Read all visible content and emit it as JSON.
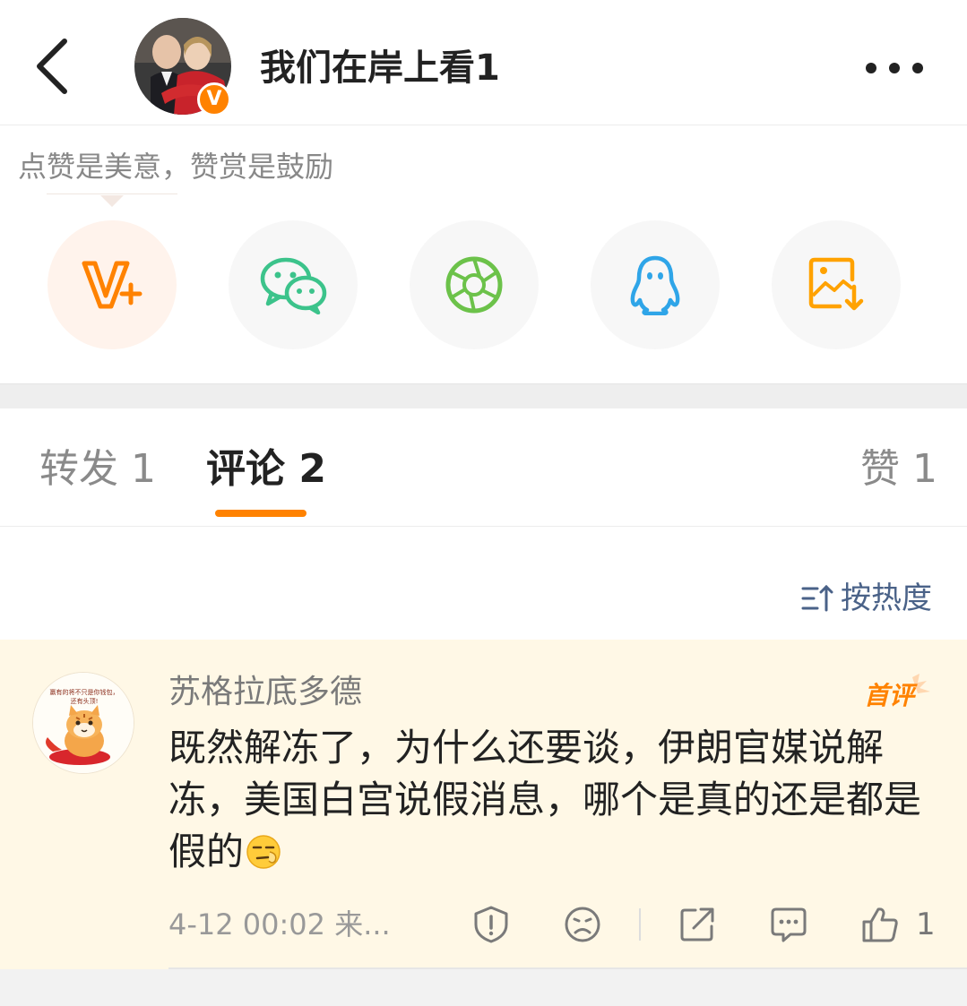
{
  "header": {
    "title": "我们在岸上看1",
    "verified_badge": "V",
    "back_icon": "chevron-left-icon",
    "more_icon": "more-dots-icon"
  },
  "reward_hint": "点赞是美意，赞赏是鼓励",
  "share": {
    "items": [
      {
        "name": "vplus",
        "icon": "v-plus-icon"
      },
      {
        "name": "wechat",
        "icon": "wechat-icon"
      },
      {
        "name": "moments",
        "icon": "moments-shutter-icon"
      },
      {
        "name": "qq",
        "icon": "qq-penguin-icon"
      },
      {
        "name": "save-image",
        "icon": "save-image-icon"
      }
    ]
  },
  "tabs": {
    "repost": "转发 1",
    "comments": "评论 2",
    "likes": "赞 1",
    "active": "comments"
  },
  "sort": {
    "label": "按热度",
    "icon": "sort-icon"
  },
  "comment": {
    "author": "苏格拉底多德",
    "badge": "首评",
    "text": "既然解冻了，为什么还要谈，伊朗官媒说解冻，美国白宫说假消息，哪个是真的还是都是假的",
    "emoji": "skeptical-face-emoji",
    "meta": "4-12 00:02 来...",
    "like_count": "1",
    "avatar_caption": "赢有的将不只是你钱包，还有头顶!",
    "actions": [
      "report-icon",
      "dislike-face-icon",
      "share-out-icon",
      "reply-icon",
      "thumbs-up-icon"
    ]
  },
  "colors": {
    "accent": "#ff8200",
    "comment_bg": "#fff8e6",
    "link_blue": "#4a6288"
  }
}
